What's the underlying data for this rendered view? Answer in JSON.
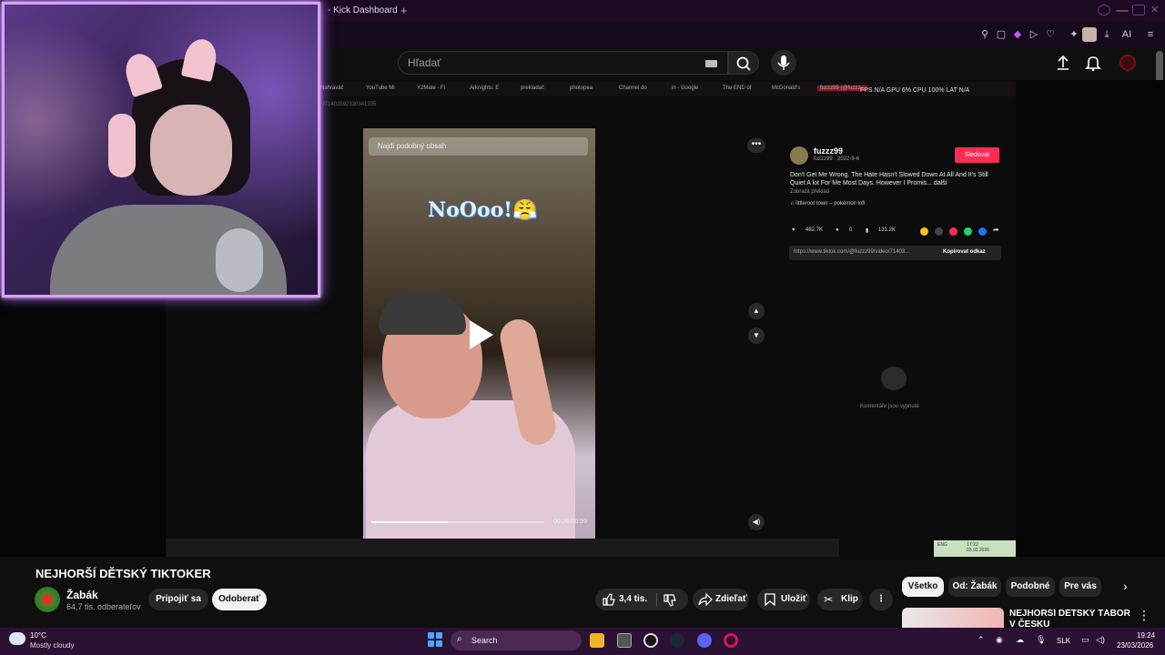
{
  "browser": {
    "tab_title": "- Kick Dashboard",
    "new_tab": "+",
    "toolbar_ai": "AI"
  },
  "youtube": {
    "search": {
      "placeholder": "Hľadať"
    },
    "video": {
      "title": "NEJHORŠÍ DĚTSKÝ TIKTOKER",
      "channel": "Žabák",
      "subscribers": "64,7 tis. odberateľov",
      "join_label": "Pripojiť sa",
      "subscribe_label": "Odoberať",
      "likes": "3,4 tis.",
      "share_label": "Zdieľať",
      "save_label": "Uložiť",
      "clip_label": "Klip",
      "more": "⋮"
    },
    "chips": [
      "Všetko",
      "Od: Žabák",
      "Podobné",
      "Pre vás"
    ],
    "recommended": {
      "title": "NEJHORŠÍ DĚTSKÝ TÁBOR V ČESKU"
    }
  },
  "inner_page": {
    "bookmarks": [
      "Nahráváč",
      "YouTube Mi",
      "Y2Mate - Fi",
      "Arknights: E",
      "prekladač",
      "photopea",
      "Channel do",
      "in - Google",
      "The END of",
      "McDonald's",
      "fuzzz99 (@fuzzz..."
    ],
    "stats": "FPS N/A   GPU 6%   CPU 100%   LAT N/A",
    "url": "/71403592330341305"
  },
  "tiktok": {
    "search_label": "Najdi podobný obsah",
    "caption": "NoOoo!😤",
    "time": "00:26/00:59",
    "progress": 0.44,
    "username": "fuzzz99",
    "subline": "fuzzz99 · 2022-9-6",
    "follow_label": "Sledovat",
    "description": "Don't Get Me Wrong. The Hate Hasn't Slowed Down At All And It's Still Quiet A lot For Me Most Days. However I Promis...   další",
    "translate": "Zobrazit překlad",
    "sound": "♫ littleroot town – pokémon lofi",
    "likes": "482.7K",
    "comments": "0",
    "saves": "131.2K",
    "link": "https://www.tiktok.com/@fuzzz99/video/71403...",
    "copy_label": "Kopírovat odkaz",
    "comments_off": "Komentáře jsou vypnuté",
    "mini_clock_time": "17:22",
    "mini_clock_date": "03.02.2026",
    "mini_clock_lang": "ENG"
  },
  "taskbar": {
    "weather_temp": "10°C",
    "weather_desc": "Mostly cloudy",
    "search_label": "Search",
    "lang": "SLK",
    "time": "19:24",
    "date": "23/03/2026"
  }
}
